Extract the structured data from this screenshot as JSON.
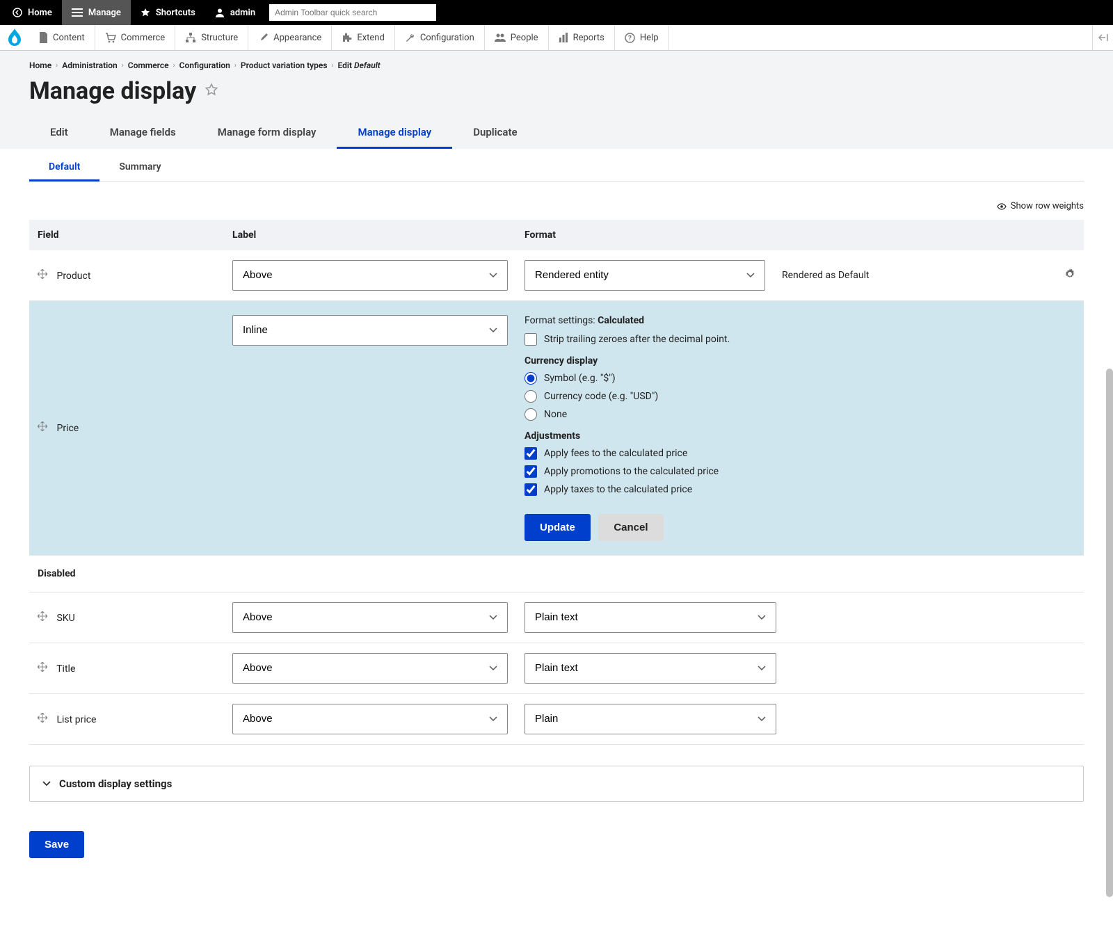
{
  "toolbar_top": {
    "home": "Home",
    "manage": "Manage",
    "shortcuts": "Shortcuts",
    "admin": "admin",
    "search_placeholder": "Admin Toolbar quick search"
  },
  "toolbar_sub": {
    "content": "Content",
    "commerce": "Commerce",
    "structure": "Structure",
    "appearance": "Appearance",
    "extend": "Extend",
    "configuration": "Configuration",
    "people": "People",
    "reports": "Reports",
    "help": "Help"
  },
  "breadcrumb": {
    "items": [
      "Home",
      "Administration",
      "Commerce",
      "Configuration",
      "Product variation types"
    ],
    "last_prefix": "Edit ",
    "last_em": "Default"
  },
  "page_title": "Manage display",
  "primary_tabs": {
    "edit": "Edit",
    "manage_fields": "Manage fields",
    "manage_form_display": "Manage form display",
    "manage_display": "Manage display",
    "duplicate": "Duplicate"
  },
  "secondary_tabs": {
    "default": "Default",
    "summary": "Summary"
  },
  "show_row_weights": "Show row weights",
  "table": {
    "headers": {
      "field": "Field",
      "label": "Label",
      "format": "Format"
    },
    "rows": {
      "product": {
        "name": "Product",
        "label_select": "Above",
        "format_select": "Rendered entity",
        "summary": "Rendered as Default"
      },
      "price": {
        "name": "Price",
        "label_select": "Inline",
        "settings_title_prefix": "Format settings: ",
        "settings_title_value": "Calculated",
        "strip_zeroes": "Strip trailing zeroes after the decimal point.",
        "currency_display_label": "Currency display",
        "currency_options": {
          "symbol": "Symbol (e.g. \"$\")",
          "code": "Currency code (e.g. \"USD\")",
          "none": "None"
        },
        "adjustments_label": "Adjustments",
        "adjustments": {
          "fees": "Apply fees to the calculated price",
          "promotions": "Apply promotions to the calculated price",
          "taxes": "Apply taxes to the calculated price"
        },
        "update_btn": "Update",
        "cancel_btn": "Cancel"
      }
    },
    "disabled_header": "Disabled",
    "disabled_rows": {
      "sku": {
        "name": "SKU",
        "label_select": "Above",
        "format_select": "Plain text"
      },
      "title": {
        "name": "Title",
        "label_select": "Above",
        "format_select": "Plain text"
      },
      "list_price": {
        "name": "List price",
        "label_select": "Above",
        "format_select": "Plain"
      }
    }
  },
  "custom_display": "Custom display settings",
  "save_btn": "Save"
}
